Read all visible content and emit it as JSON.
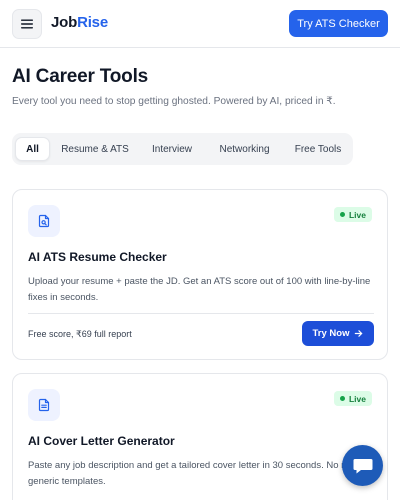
{
  "header": {
    "logo_part1": "Job",
    "logo_part2": "Rise",
    "cta_label": "Try ATS Checker",
    "menu_icon": "hamburger-icon"
  },
  "hero": {
    "title": "AI Career Tools",
    "subtitle": "Every tool you need to stop getting ghosted. Powered by AI, priced in ₹."
  },
  "tabs": [
    {
      "label": "All",
      "active": true
    },
    {
      "label": "Resume & ATS",
      "active": false
    },
    {
      "label": "Interview",
      "active": false
    },
    {
      "label": "Networking",
      "active": false
    },
    {
      "label": "Free Tools",
      "active": false
    }
  ],
  "cards": [
    {
      "icon": "document-search-icon",
      "badge": "Live",
      "title": "AI ATS Resume Checker",
      "description": "Upload your resume + paste the JD. Get an ATS score out of 100 with line-by-line fixes in seconds.",
      "price": "Free score, ₹69 full report",
      "action_label": "Try Now"
    },
    {
      "icon": "document-text-icon",
      "badge": "Live",
      "title": "AI Cover Letter Generator",
      "description": "Paste any job description and get a tailored cover letter in 30 seconds. No more generic templates."
    }
  ],
  "chat": {
    "icon": "chat-icon"
  },
  "colors": {
    "brand": "#2563eb",
    "brand_dark": "#1d4ed8",
    "live_bg": "#dcfce7",
    "live_text": "#15803d",
    "chat": "#1e5bb8"
  }
}
